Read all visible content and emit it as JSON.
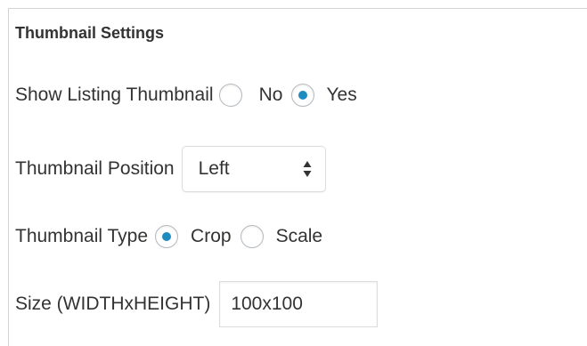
{
  "section": {
    "title": "Thumbnail Settings"
  },
  "show_thumbnail": {
    "label": "Show Listing Thumbnail",
    "options": [
      {
        "label": "No",
        "selected": false
      },
      {
        "label": "Yes",
        "selected": true
      }
    ]
  },
  "position": {
    "label": "Thumbnail Position",
    "selected_value": "Left"
  },
  "type": {
    "label": "Thumbnail Type",
    "options": [
      {
        "label": "Crop",
        "selected": true
      },
      {
        "label": "Scale",
        "selected": false
      }
    ]
  },
  "size": {
    "label": "Size (WIDTHxHEIGHT)",
    "value": "100x100"
  },
  "colors": {
    "radio_accent": "#1e8cbe",
    "text": "#333333",
    "border": "#dcdcdc"
  }
}
